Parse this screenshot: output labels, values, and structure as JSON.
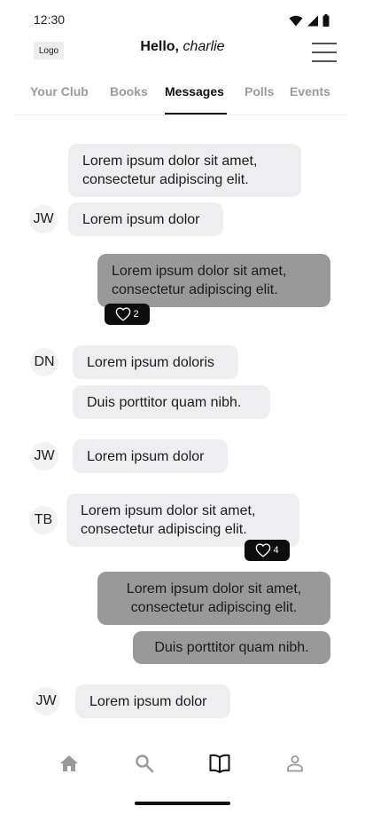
{
  "status": {
    "time": "12:30"
  },
  "header": {
    "logo": "Logo",
    "greeting_prefix": "Hello,",
    "user_name": "charlie"
  },
  "tabs": [
    {
      "label": "Your  Club"
    },
    {
      "label": "Books"
    },
    {
      "label": "Messages",
      "active": true
    },
    {
      "label": "Polls"
    },
    {
      "label": "Events"
    }
  ],
  "messages": [
    {
      "text_line1": "Lorem ipsum dolor sit amet,",
      "text_line2": "consectetur adipiscing elit."
    },
    {
      "sender": "JW",
      "text": "Lorem ipsum dolor"
    },
    {
      "text_line1": "Lorem ipsum dolor sit amet,",
      "text_line2": "consectetur adipiscing elit.",
      "reactions": "2"
    },
    {
      "sender": "DN",
      "text": "Lorem ipsum doloris"
    },
    {
      "text": "Duis porttitor quam nibh."
    },
    {
      "sender": "JW",
      "text": "Lorem ipsum dolor"
    },
    {
      "sender": "TB",
      "text_line1": "Lorem ipsum dolor sit amet,",
      "text_line2": "consectetur adipiscing elit.",
      "reactions": "4"
    },
    {
      "text_line1": "Lorem ipsum dolor sit amet,",
      "text_line2": "consectetur adipiscing elit."
    },
    {
      "text": "Duis porttitor quam nibh."
    },
    {
      "sender": "JW",
      "text": "Lorem ipsum dolor"
    }
  ],
  "bottom_nav": [
    {
      "icon": "home-icon"
    },
    {
      "icon": "search-icon"
    },
    {
      "icon": "book-icon",
      "active": true
    },
    {
      "icon": "profile-icon"
    }
  ],
  "colors": {
    "incoming_bubble": "#eeeef1",
    "outgoing_bubble": "#999999",
    "reaction_badge": "#0d0d0d",
    "inactive_tab": "#9b9b9b"
  }
}
